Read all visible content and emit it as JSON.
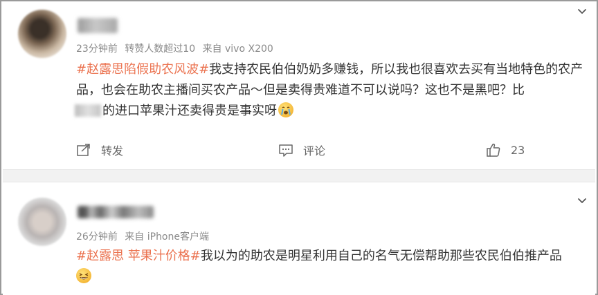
{
  "posts": [
    {
      "meta": {
        "time": "23分钟前",
        "reposts": "转赞人数超过10",
        "source": "来自 vivo X200"
      },
      "hashtag": "#赵露思陷假助农风波#",
      "text_1": "我支持农民伯伯奶奶多赚钱，所以我也很喜欢去买有当地特色的农产品，也会在助农主播间买农产品～但是卖得贵难道不可以说吗？这也不是黑吧？比",
      "text_2": "的进口苹果汁还卖得贵是事实呀",
      "emoji": "crying-face",
      "actions": {
        "repost_label": "转发",
        "comment_label": "评论",
        "like_count": "23"
      }
    },
    {
      "meta": {
        "time": "26分钟前",
        "source": "来自 iPhone客户端"
      },
      "hashtag": "#赵露思 苹果汁价格#",
      "text_1": "我以为的助农是明星利用自己的名气无偿帮助那些农民伯伯推产品",
      "emoji": "laughing-face"
    }
  ],
  "colors": {
    "hashtag": "#eb7350",
    "meta": "#8a8a8a",
    "text": "#333333",
    "separator": "#f2f2f2"
  }
}
